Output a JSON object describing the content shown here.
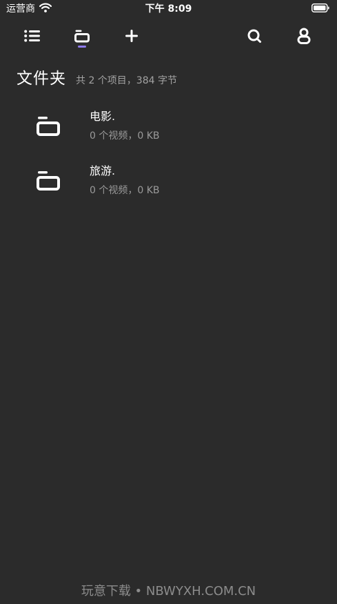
{
  "status_bar": {
    "carrier": "运营商",
    "time": "下午 8:09"
  },
  "header": {
    "title": "文件夹",
    "summary": "共 2 个项目，384 字节"
  },
  "folders": [
    {
      "name": "电影.",
      "meta": "0 个视频，0 KB"
    },
    {
      "name": "旅游.",
      "meta": "0 个视频，0 KB"
    }
  ],
  "icons": {
    "menu": "list-icon",
    "folders_tab": "folder-icon",
    "add": "plus-icon",
    "search": "search-icon",
    "profile": "user-icon"
  },
  "colors": {
    "background": "#2b2b2b",
    "active_indicator": "#8f7bf0",
    "primary_text": "#ffffff",
    "secondary_text": "#9a9a9a"
  },
  "watermark": "玩意下载 • NBWYXH.COM.CN"
}
